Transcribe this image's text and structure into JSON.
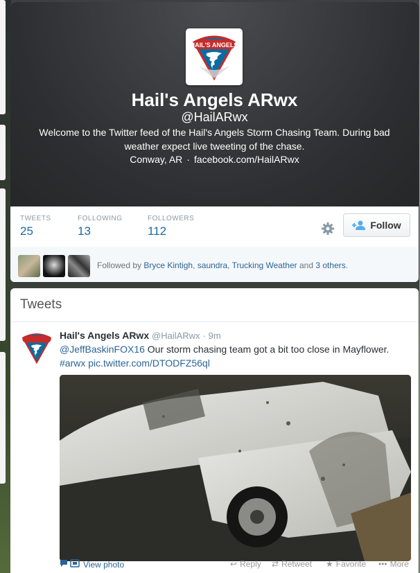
{
  "profile": {
    "name": "Hail's Angels ARwx",
    "handle": "@HailARwx",
    "bio": "Welcome to the Twitter feed of the Hail's Angels Storm Chasing Team. During bad weather expect live tweeting of the chase.",
    "location": "Conway, AR",
    "separator": "·",
    "website": "facebook.com/HailARwx",
    "logo_text": "HAIL'S ANGELS"
  },
  "stats": {
    "tweets_label": "TWEETS",
    "tweets_value": "25",
    "following_label": "FOLLOWING",
    "following_value": "13",
    "followers_label": "FOLLOWERS",
    "followers_value": "112"
  },
  "follow_button": {
    "label": "Follow"
  },
  "followed_by": {
    "prefix": "Followed by",
    "users": [
      "Bryce Kintigh",
      "saundra",
      "Trucking Weather"
    ],
    "sep1": ",",
    "sep2": ",",
    "and": "and",
    "others": "3 others",
    "suffix": "."
  },
  "tweets": {
    "title": "Tweets",
    "tweet": {
      "name": "Hail's Angels ARwx",
      "handle": "@HailARwx",
      "dot": "·",
      "time": "9m",
      "mention": "@JeffBaskinFOX16",
      "text": " Our storm chasing team got a bit too close in Mayflower.",
      "hashtag": "#arwx",
      "link": "pic.twitter.com/DTODFZ56ql",
      "actions": {
        "view_photo": "View photo",
        "reply": "Reply",
        "retweet": "Retweet",
        "favorite": "Favorite",
        "more": "More"
      }
    }
  },
  "colors": {
    "link": "#2a6496",
    "stat_value": "#1a6b9c",
    "header_bg": "#2d2e31"
  }
}
